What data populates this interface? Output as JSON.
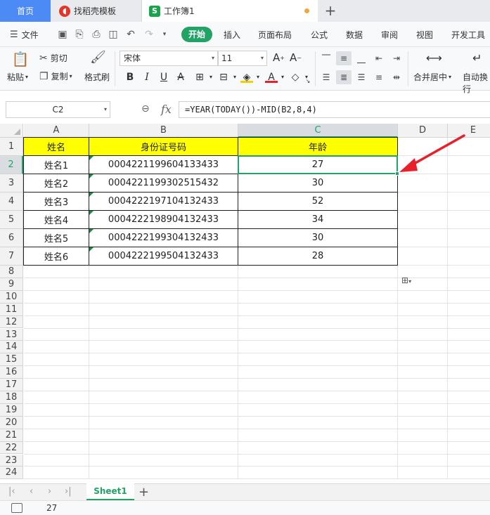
{
  "tabs": {
    "home": "首页",
    "template": "找稻壳模板",
    "document": "工作簿1"
  },
  "menu": {
    "file": "文件",
    "items": [
      "开始",
      "插入",
      "页面布局",
      "公式",
      "数据",
      "审阅",
      "视图",
      "开发工具"
    ]
  },
  "ribbon": {
    "paste": "粘贴",
    "cut": "剪切",
    "copy": "复制",
    "format_painter": "格式刷",
    "font_name": "宋体",
    "font_size": "11",
    "merge_center": "合并居中",
    "wrap_text": "自动换行"
  },
  "formula_bar": {
    "name_box": "C2",
    "fx": "fx",
    "formula": "=YEAR(TODAY())-MID(B2,8,4)"
  },
  "grid": {
    "columns": [
      "A",
      "B",
      "C",
      "D",
      "E"
    ],
    "rows": [
      "1",
      "2",
      "3",
      "4",
      "5",
      "6",
      "7",
      "8",
      "9",
      "10",
      "11",
      "12",
      "13",
      "14",
      "15",
      "16",
      "17",
      "18",
      "19",
      "20",
      "21",
      "22",
      "23",
      "24"
    ],
    "header": [
      "姓名",
      "身份证号码",
      "年龄"
    ],
    "data": [
      [
        "姓名1",
        "0004221199604133433",
        "27"
      ],
      [
        "姓名2",
        "0004221199302515432",
        "30"
      ],
      [
        "姓名3",
        "0004222197104132433",
        "52"
      ],
      [
        "姓名4",
        "0004222198904132433",
        "34"
      ],
      [
        "姓名5",
        "0004222199304132433",
        "30"
      ],
      [
        "姓名6",
        "0004222199504132433",
        "28"
      ]
    ],
    "selected_cell": "C2"
  },
  "sheets": {
    "active": "Sheet1",
    "add": "+"
  },
  "status": {
    "value": "27"
  },
  "colors": {
    "accent": "#21a366",
    "header_fill": "#ffff00",
    "home_tab": "#4c8bf5",
    "annotation": "#e8202a"
  }
}
